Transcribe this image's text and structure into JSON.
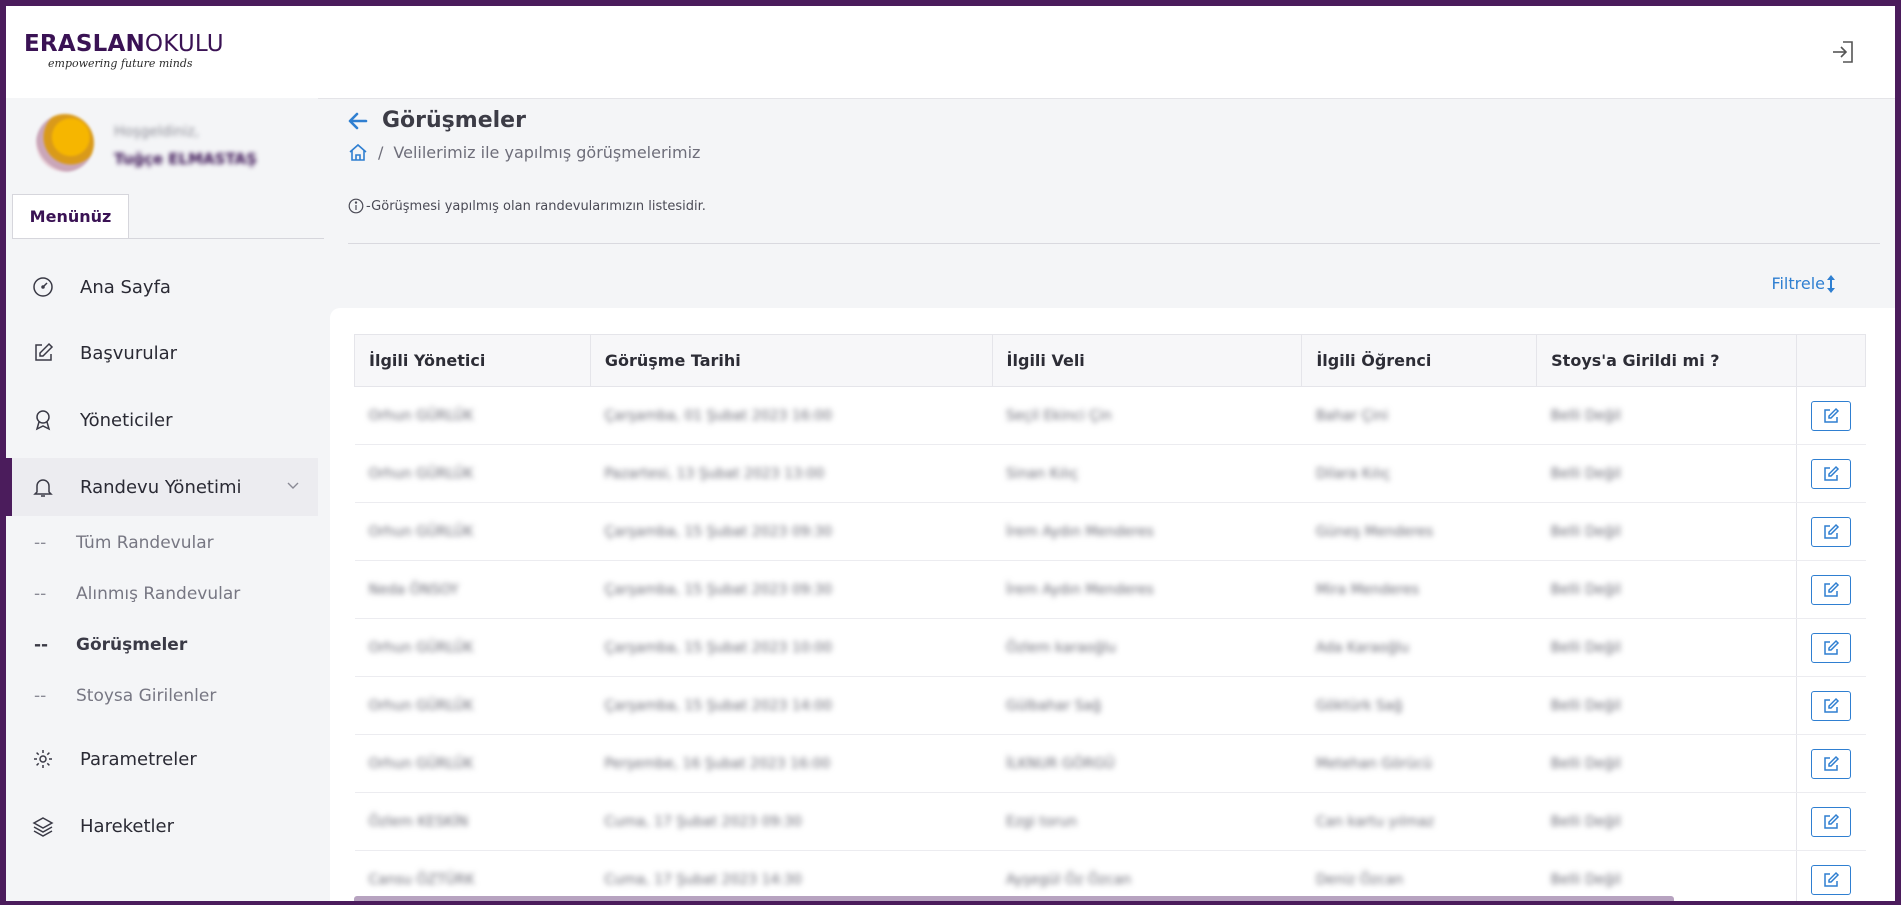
{
  "app": {
    "logo_bold": "ERASLAN",
    "logo_light": "OKULU",
    "logo_tagline": "empowering future minds"
  },
  "user": {
    "greeting": "Hoşgeldiniz,",
    "name": "Tuğçe ELMASTAŞ"
  },
  "sidebar": {
    "tab_label": "Menünüz",
    "items": [
      {
        "label": "Ana Sayfa",
        "icon": "speedometer-icon"
      },
      {
        "label": "Başvurular",
        "icon": "edit-icon"
      },
      {
        "label": "Yöneticiler",
        "icon": "award-icon"
      },
      {
        "label": "Randevu Yönetimi",
        "icon": "bell-icon"
      },
      {
        "label": "Parametreler",
        "icon": "gear-icon"
      },
      {
        "label": "Hareketler",
        "icon": "layers-icon"
      }
    ],
    "sub_items": [
      {
        "dash": "--",
        "label": "Tüm Randevular"
      },
      {
        "dash": "--",
        "label": "Alınmış Randevular"
      },
      {
        "dash": "--",
        "label": "Görüşmeler"
      },
      {
        "dash": "--",
        "label": "Stoysa Girilenler"
      }
    ]
  },
  "main": {
    "title": "Görüşmeler",
    "breadcrumb_sep": "/",
    "breadcrumb": "Velilerimiz ile yapılmış görüşmelerimiz",
    "info": "-Görüşmesi yapılmış olan randevularımızın listesidir.",
    "filter_label": "Filtrele"
  },
  "table": {
    "headers": [
      "İlgili Yönetici",
      "Görüşme Tarihi",
      "İlgili Veli",
      "İlgili Öğrenci",
      "Stoys'a Girildi mi ?"
    ],
    "rows": [
      [
        "Orhun GÜRLÜK",
        "Çarşamba, 01 Şubat 2023 16:00",
        "Seçil Ekinci Çin",
        "Bahar Çini",
        "Belli Değil"
      ],
      [
        "Orhun GÜRLÜK",
        "Pazartesi, 13 Şubat 2023 13:00",
        "Sinan Kılıç",
        "Dilara Kılıç",
        "Belli Değil"
      ],
      [
        "Orhun GÜRLÜK",
        "Çarşamba, 15 Şubat 2023 09:30",
        "İrem Aydın Menderes",
        "Güneş Menderes",
        "Belli Değil"
      ],
      [
        "Neda ÖNSOY",
        "Çarşamba, 15 Şubat 2023 09:30",
        "İrem Aydın Menderes",
        "Mira Menderes",
        "Belli Değil"
      ],
      [
        "Orhun GÜRLÜK",
        "Çarşamba, 15 Şubat 2023 10:00",
        "Özlem karaoğlu",
        "Ada Karaoğlu",
        "Belli Değil"
      ],
      [
        "Orhun GÜRLÜK",
        "Çarşamba, 15 Şubat 2023 14:00",
        "Gülbahar Sağ",
        "Göktürk Sağ",
        "Belli Değil"
      ],
      [
        "Orhun GÜRLÜK",
        "Perşembe, 16 Şubat 2023 16:00",
        "İLKNUR GÖRGÜ",
        "Metehan Görücü",
        "Belli Değil"
      ],
      [
        "Özlem KESKİN",
        "Cuma, 17 Şubat 2023 09:30",
        "Ezgi torun",
        "Can kartu yılmaz",
        "Belli Değil"
      ],
      [
        "Cansu ÖZTÜRK",
        "Cuma, 17 Şubat 2023 14:30",
        "Ayşegül Öz Özcan",
        "Deniz Özcan",
        "Belli Değil"
      ]
    ]
  },
  "colors": {
    "brand": "#4b1c5c",
    "accent": "#2f7fd1"
  }
}
